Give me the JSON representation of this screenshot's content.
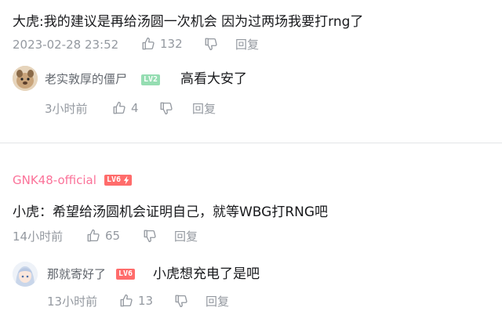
{
  "comment1": {
    "text": "大虎:我的建议是再给汤圆一次机会 因为过两场我要打rng了",
    "time": "2023-02-28 23:52",
    "likes": "132",
    "reply_label": "回复"
  },
  "reply1": {
    "username": "老实敦厚的僵尸",
    "level": "LV2",
    "level_color": "#95ddb2",
    "text": "高看大安了",
    "time": "3小时前",
    "likes": "4",
    "reply_label": "回复"
  },
  "comment2": {
    "username": "GNK48-official",
    "level": "LV6",
    "level_color": "#ff6c6b",
    "name_color": "#fb7299",
    "text": "小虎：希望给汤圆机会证明自己，就等WBG打RNG吧",
    "time": "14小时前",
    "likes": "65",
    "reply_label": "回复"
  },
  "reply2": {
    "username": "那就寄好了",
    "level": "LV6",
    "level_color": "#ff6c6b",
    "text": "小虎想充电了是吧",
    "time": "13小时前",
    "likes": "13",
    "reply_label": "回复"
  },
  "icons": {
    "like": "thumbs-up-icon",
    "dislike": "thumbs-down-icon",
    "lightning": "lightning-icon"
  }
}
